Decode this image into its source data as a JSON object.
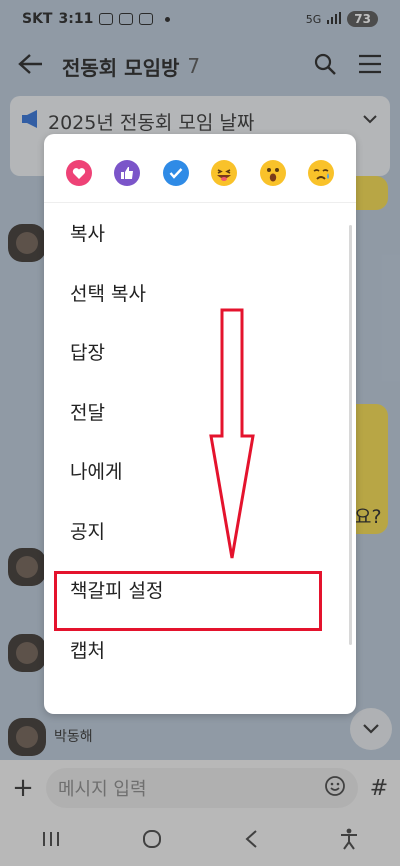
{
  "status_bar": {
    "carrier": "SKT",
    "time": "3:11",
    "battery": "73",
    "network": "5G"
  },
  "app_bar": {
    "title": "전동회 모임방",
    "member_count": "7"
  },
  "notice": {
    "text": "2025년 전동회 모임 날짜"
  },
  "chat": {
    "partial_text": "요?",
    "sender": "박동해"
  },
  "menu": {
    "reactions": [
      "heart",
      "thumbs-up",
      "check",
      "grinning-tongue",
      "surprised",
      "sad-tear"
    ],
    "items": [
      "복사",
      "선택 복사",
      "답장",
      "전달",
      "나에게",
      "공지",
      "책갈피 설정",
      "캡처"
    ]
  },
  "input": {
    "placeholder": "메시지 입력"
  },
  "colors": {
    "highlight": "#e4132d",
    "yellow_bubble": "#f3d94a"
  }
}
